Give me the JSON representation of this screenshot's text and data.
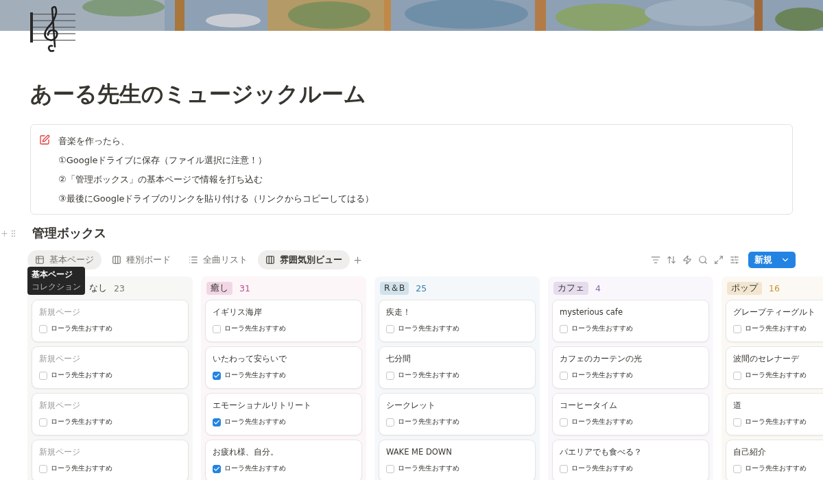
{
  "page": {
    "title": "あーる先生のミュージックルーム"
  },
  "callout": {
    "lines": [
      {
        "text": "音楽を作ったら、"
      },
      {
        "text": "①Googleドライブに保存（ファイル選択に注意！）"
      },
      {
        "text": "②「管理ボックス」の基本ページで情報を打ち込む"
      },
      {
        "text": "③最後にGoogleドライブのリンクを貼り付ける（リンクからコピーしてはる）"
      }
    ]
  },
  "database": {
    "title": "管理ボックス",
    "tabs": [
      {
        "label": "基本ページ",
        "kind": "table",
        "selected": false,
        "hovered": true
      },
      {
        "label": "種別ボード",
        "kind": "board",
        "selected": false,
        "hovered": false
      },
      {
        "label": "全曲リスト",
        "kind": "list",
        "selected": false,
        "hovered": false
      },
      {
        "label": "雰囲気別ビュー",
        "kind": "board",
        "selected": true,
        "hovered": false
      }
    ],
    "tooltip": {
      "title": "基本ページ",
      "subtitle": "コレクション"
    },
    "new_button": "新規",
    "groups": [
      {
        "label": "なし",
        "count": "23",
        "kind": "plain",
        "color": "#787774",
        "cards": [
          {
            "title": "新規ページ",
            "untitled": true,
            "checkbox": "ローラ先生おすすめ",
            "checked": false
          },
          {
            "title": "新規ページ",
            "untitled": true,
            "checkbox": "ローラ先生おすすめ",
            "checked": false
          },
          {
            "title": "新規ページ",
            "untitled": true,
            "checkbox": "ローラ先生おすすめ",
            "checked": false
          },
          {
            "title": "新規ページ",
            "untitled": true,
            "checkbox": "ローラ先生おすすめ",
            "checked": false
          }
        ]
      },
      {
        "label": "癒し",
        "count": "31",
        "kind": "tag",
        "color": "#c14c8a",
        "cards": [
          {
            "title": "イギリス海岸",
            "untitled": false,
            "checkbox": "ローラ先生おすすめ",
            "checked": false
          },
          {
            "title": "いたわって安らいで",
            "untitled": false,
            "checkbox": "ローラ先生おすすめ",
            "checked": true
          },
          {
            "title": "エモーショナルリトリート",
            "untitled": false,
            "checkbox": "ローラ先生おすすめ",
            "checked": true
          },
          {
            "title": "お疲れ様、自分。",
            "untitled": false,
            "checkbox": "ローラ先生おすすめ",
            "checked": true
          }
        ]
      },
      {
        "label": "R＆B",
        "count": "25",
        "kind": "tag",
        "color": "#337ea9",
        "cards": [
          {
            "title": "疾走！",
            "untitled": false,
            "checkbox": "ローラ先生おすすめ",
            "checked": false
          },
          {
            "title": "七分間",
            "untitled": false,
            "checkbox": "ローラ先生おすすめ",
            "checked": false
          },
          {
            "title": "シークレット",
            "untitled": false,
            "checkbox": "ローラ先生おすすめ",
            "checked": false
          },
          {
            "title": "WAKE ME DOWN",
            "untitled": false,
            "checkbox": "ローラ先生おすすめ",
            "checked": false
          }
        ]
      },
      {
        "label": "カフェ",
        "count": "4",
        "kind": "tag",
        "color": "#9065b0",
        "cards": [
          {
            "title": "mysterious cafe",
            "untitled": false,
            "checkbox": "ローラ先生おすすめ",
            "checked": false
          },
          {
            "title": "カフェのカーテンの光",
            "untitled": false,
            "checkbox": "ローラ先生おすすめ",
            "checked": false
          },
          {
            "title": "コーヒータイム",
            "untitled": false,
            "checkbox": "ローラ先生おすすめ",
            "checked": false
          },
          {
            "title": "パエリアでも食べる？",
            "untitled": false,
            "checkbox": "ローラ先生おすすめ",
            "checked": false
          }
        ]
      },
      {
        "label": "ポップ",
        "count": "16",
        "kind": "tag",
        "color": "#cb912f",
        "cards": [
          {
            "title": "グレープティーグルト",
            "untitled": false,
            "checkbox": "ローラ先生おすすめ",
            "checked": false
          },
          {
            "title": "波間のセレナーデ",
            "untitled": false,
            "checkbox": "ローラ先生おすすめ",
            "checked": false
          },
          {
            "title": "道",
            "untitled": false,
            "checkbox": "ローラ先生おすすめ",
            "checked": false
          },
          {
            "title": "自己紹介",
            "untitled": false,
            "checkbox": "ローラ先生おすすめ",
            "checked": false
          }
        ]
      }
    ]
  }
}
